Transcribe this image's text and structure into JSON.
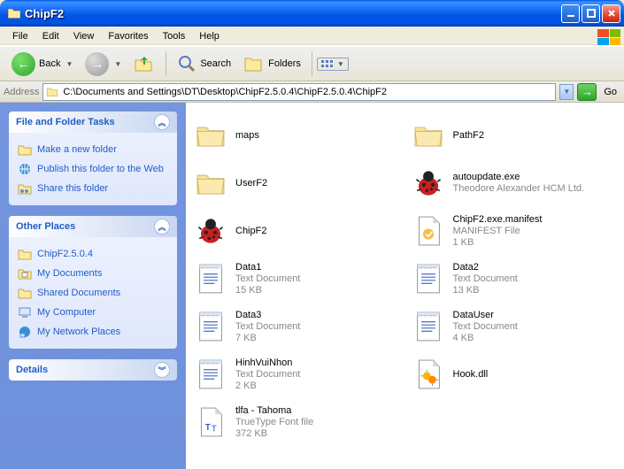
{
  "window": {
    "title": "ChipF2"
  },
  "menu": [
    "File",
    "Edit",
    "View",
    "Favorites",
    "Tools",
    "Help"
  ],
  "toolbar": {
    "back": "Back",
    "search": "Search",
    "folders": "Folders"
  },
  "address": {
    "label": "Address",
    "path": "C:\\Documents and Settings\\DT\\Desktop\\ChipF2.5.0.4\\ChipF2.5.0.4\\ChipF2",
    "go": "Go"
  },
  "sidebar": {
    "tasks": {
      "title": "File and Folder Tasks",
      "items": [
        {
          "label": "Make a new folder",
          "icon": "folder"
        },
        {
          "label": "Publish this folder to the Web",
          "icon": "globe"
        },
        {
          "label": "Share this folder",
          "icon": "share"
        }
      ]
    },
    "places": {
      "title": "Other Places",
      "items": [
        {
          "label": "ChipF2.5.0.4",
          "icon": "folder"
        },
        {
          "label": "My Documents",
          "icon": "docs"
        },
        {
          "label": "Shared Documents",
          "icon": "folder"
        },
        {
          "label": "My Computer",
          "icon": "computer"
        },
        {
          "label": "My Network Places",
          "icon": "network"
        }
      ]
    },
    "details": {
      "title": "Details"
    }
  },
  "files": [
    {
      "name": "maps",
      "type": "folder",
      "sub1": "",
      "sub2": ""
    },
    {
      "name": "PathF2",
      "type": "folder",
      "sub1": "",
      "sub2": ""
    },
    {
      "name": "UserF2",
      "type": "folder",
      "sub1": "",
      "sub2": ""
    },
    {
      "name": "autoupdate.exe",
      "type": "bug",
      "sub1": "Theodore Alexander HCM Ltd.",
      "sub2": ""
    },
    {
      "name": "ChipF2",
      "type": "bug",
      "sub1": "",
      "sub2": ""
    },
    {
      "name": "ChipF2.exe.manifest",
      "type": "manifest",
      "sub1": "MANIFEST File",
      "sub2": "1 KB"
    },
    {
      "name": "Data1",
      "type": "text",
      "sub1": "Text Document",
      "sub2": "15 KB"
    },
    {
      "name": "Data2",
      "type": "text",
      "sub1": "Text Document",
      "sub2": "13 KB"
    },
    {
      "name": "Data3",
      "type": "text",
      "sub1": "Text Document",
      "sub2": "7 KB"
    },
    {
      "name": "DataUser",
      "type": "text",
      "sub1": "Text Document",
      "sub2": "4 KB"
    },
    {
      "name": "HinhVuiNhon",
      "type": "text",
      "sub1": "Text Document",
      "sub2": "2 KB"
    },
    {
      "name": "Hook.dll",
      "type": "dll",
      "sub1": "",
      "sub2": ""
    },
    {
      "name": "tlfa - Tahoma",
      "type": "font",
      "sub1": "TrueType Font file",
      "sub2": "372 KB"
    }
  ]
}
